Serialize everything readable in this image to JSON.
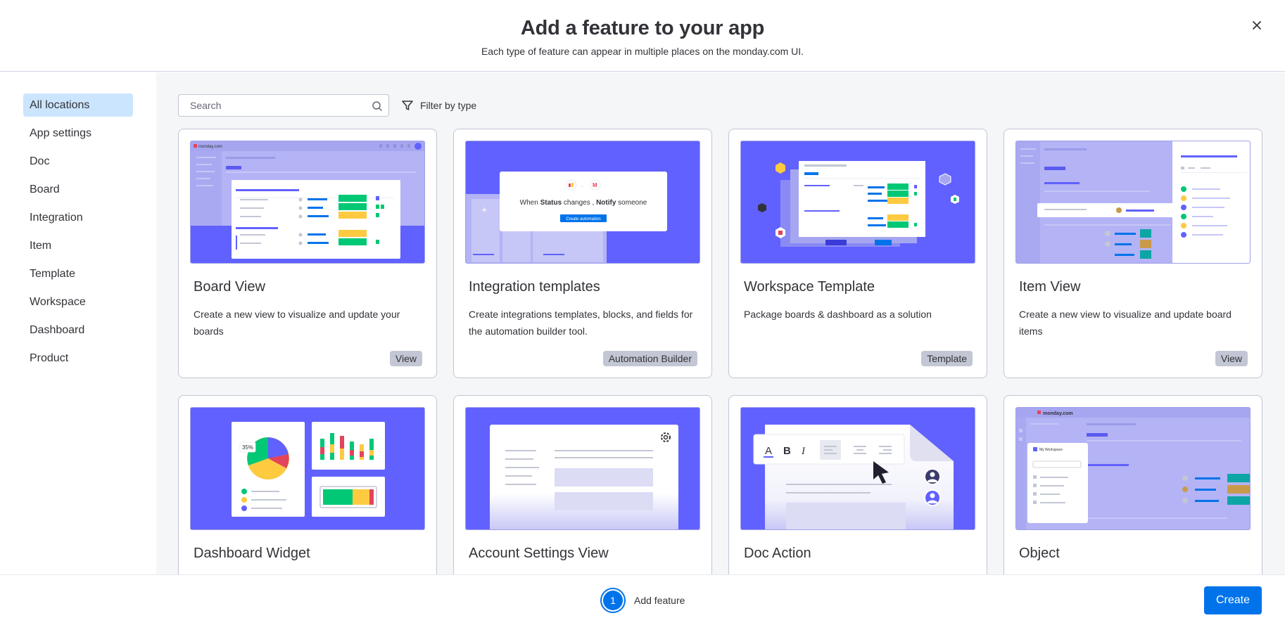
{
  "header": {
    "title": "Add a feature to your app",
    "subtitle": "Each type of feature can appear in multiple places on the monday.com UI."
  },
  "sidebar": {
    "items": [
      {
        "label": "All locations",
        "active": true
      },
      {
        "label": "App settings"
      },
      {
        "label": "Doc"
      },
      {
        "label": "Board"
      },
      {
        "label": "Integration"
      },
      {
        "label": "Item"
      },
      {
        "label": "Template"
      },
      {
        "label": "Workspace"
      },
      {
        "label": "Dashboard"
      },
      {
        "label": "Product"
      }
    ]
  },
  "toolbar": {
    "search_placeholder": "Search",
    "filter_label": "Filter by type"
  },
  "cards": [
    {
      "title": "Board View",
      "description": "Create a new view to visualize and update your boards",
      "tag": "View"
    },
    {
      "title": "Integration templates",
      "description": "Create integrations templates, blocks, and fields for the automation builder tool.",
      "tag": "Automation Builder"
    },
    {
      "title": "Workspace Template",
      "description": "Package boards & dashboard as a solution",
      "tag": "Template"
    },
    {
      "title": "Item View",
      "description": "Create a new view to visualize and update board items",
      "tag": "View"
    },
    {
      "title": "Dashboard Widget"
    },
    {
      "title": "Account Settings View"
    },
    {
      "title": "Doc Action"
    },
    {
      "title": "Object"
    }
  ],
  "thumbnails": {
    "board_view_logo": "monday.com",
    "integration_sentence": {
      "a": "When ",
      "b": "Status",
      "c": " changes , ",
      "d": "Notify",
      "e": " someone"
    },
    "integration_button": "Create automation",
    "widget_percent": "35%",
    "object_logo": "monday.com",
    "object_workspace": "My Workspace"
  },
  "footer": {
    "step_number": "1",
    "step_label": "Add feature",
    "create_label": "Create"
  },
  "colors": {
    "brand": "#6161ff",
    "primary": "#0073ea",
    "green": "#00c875",
    "yellow": "#fdca40",
    "red": "#e2445c"
  }
}
